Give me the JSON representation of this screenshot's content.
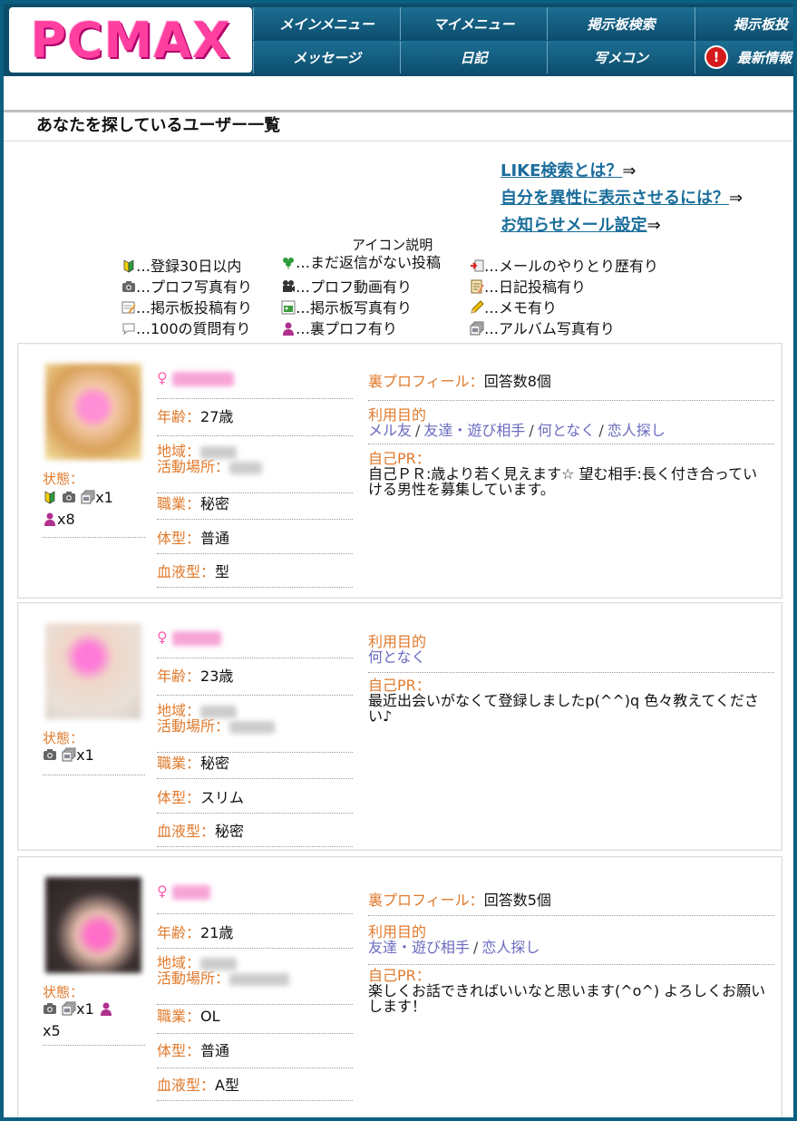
{
  "logo": {
    "text": "PCMAX"
  },
  "nav": {
    "row1": [
      "メインメニュー",
      "マイメニュー",
      "掲示板検索",
      "掲示板投"
    ],
    "row2": [
      "メッセージ",
      "日記",
      "写メコン",
      "最新情報"
    ],
    "alert_glyph": "!"
  },
  "page_title": "あなたを探しているユーザー一覧",
  "links": [
    {
      "label": "LIKE検索とは？",
      "arrow": "⇒"
    },
    {
      "label": "自分を異性に表示させるには？",
      "arrow": "⇒"
    },
    {
      "label": "お知らせメール設定",
      "arrow": "⇒"
    }
  ],
  "legend": {
    "title": "アイコン説明",
    "items": [
      {
        "icon": "beginner-mark-icon",
        "text": "…登録30日以内"
      },
      {
        "icon": "clover-icon",
        "text": "…まだ返信がない投稿"
      },
      {
        "icon": "mail-history-icon",
        "text": "…メールのやりとり歴有り"
      },
      {
        "icon": "camera-icon",
        "text": "…プロフ写真有り"
      },
      {
        "icon": "video-camera-icon",
        "text": "…プロフ動画有り"
      },
      {
        "icon": "diary-icon",
        "text": "…日記投稿有り"
      },
      {
        "icon": "board-post-icon",
        "text": "…掲示板投稿有り"
      },
      {
        "icon": "board-photo-icon",
        "text": "…掲示板写真有り"
      },
      {
        "icon": "pencil-icon",
        "text": "…メモ有り"
      },
      {
        "icon": "speech-bubble-icon",
        "text": "…100の質問有り"
      },
      {
        "icon": "person-icon",
        "text": "…裏プロフ有り"
      },
      {
        "icon": "album-icon",
        "text": "…アルバム写真有り"
      }
    ]
  },
  "labels": {
    "status": "状態：",
    "gender": "♀",
    "age": "年齢：",
    "region": "地域：",
    "activity": "活動場所：",
    "job": "職業：",
    "body": "体型：",
    "blood": "血液型：",
    "ura": "裏プロフィール：",
    "purpose": "利用目的",
    "pr": "自己PR："
  },
  "users": [
    {
      "status_line1": "x1",
      "status_line2": "x8",
      "age": "27歳",
      "job": "秘密",
      "body": "普通",
      "blood": "型",
      "ura": "回答数8個",
      "purposes": [
        "メル友",
        "友達・遊び相手",
        "何となく",
        "恋人探し"
      ],
      "pr": "自己ＰＲ:歳より若く見えます☆ 望む相手:長く付き合っていける男性を募集しています。"
    },
    {
      "status_line1": "x1",
      "age": "23歳",
      "job": "秘密",
      "body": "スリム",
      "blood": "秘密",
      "purposes": [
        "何となく"
      ],
      "pr": "最近出会いがなくて登録しましたp(^^)q 色々教えてください♪"
    },
    {
      "status_line1": "x1",
      "status_line2": "x5",
      "age": "21歳",
      "job": "OL",
      "body": "普通",
      "blood": "A型",
      "ura": "回答数5個",
      "purposes": [
        "友達・遊び相手",
        "恋人探し"
      ],
      "pr": "楽しくお話できればいいなと思います(^o^) よろしくお願いします！"
    }
  ],
  "colors": {
    "header": "#0d4d6b",
    "accent_pink": "#ff3fa0",
    "label_orange": "#e07a2c",
    "link_blue": "#1a6d9b",
    "purpose_purple": "#6a6ac0"
  }
}
